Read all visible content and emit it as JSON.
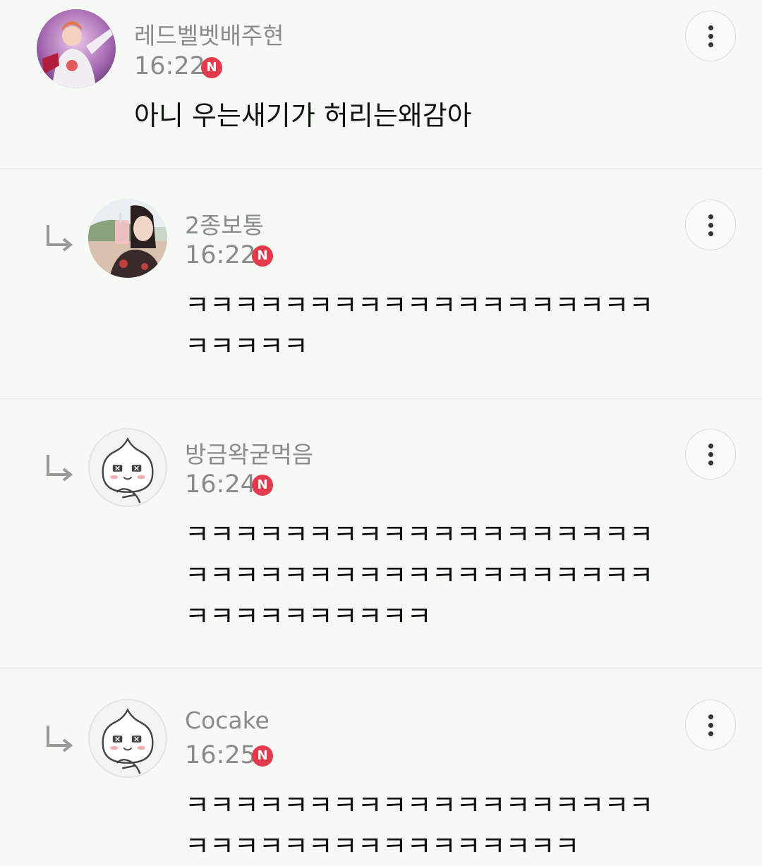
{
  "comments": [
    {
      "author": "레드벨벳배주현",
      "time": "16:22",
      "badge": "N",
      "text": "아니 우는새기가 허리는왜감아",
      "avatar_icon": "profile-photo-avatar"
    },
    {
      "author": "2종보통",
      "time": "16:22",
      "badge": "N",
      "text": "ㅋㅋㅋㅋㅋㅋㅋㅋㅋㅋㅋㅋㅋㅋㅋㅋㅋㅋㅋ\nㅋㅋㅋㅋㅋ",
      "avatar_icon": "profile-photo-avatar"
    },
    {
      "author": "방금왁굳먹음",
      "time": "16:24",
      "badge": "N",
      "text": "ㅋㅋㅋㅋㅋㅋㅋㅋㅋㅋㅋㅋㅋㅋㅋㅋㅋㅋㅋ\nㅋㅋㅋㅋㅋㅋㅋㅋㅋㅋㅋㅋㅋㅋㅋㅋㅋㅋㅋ\nㅋㅋㅋㅋㅋㅋㅋㅋㅋㅋ",
      "avatar_icon": "default-character-avatar"
    },
    {
      "author": "Cocake",
      "time": "16:25",
      "badge": "N",
      "text": "ㅋㅋㅋㅋㅋㅋㅋㅋㅋㅋㅋㅋㅋㅋㅋㅋㅋㅋㅋ\nㅋㅋㅋㅋㅋㅋㅋㅋㅋㅋㅋㅋㅋㅋㅋㅋ",
      "avatar_icon": "default-character-avatar"
    }
  ],
  "colors": {
    "background": "#f6faf5",
    "badge": "#e23b4e",
    "meta_text": "#8a8a8a",
    "body_text": "#111111"
  }
}
